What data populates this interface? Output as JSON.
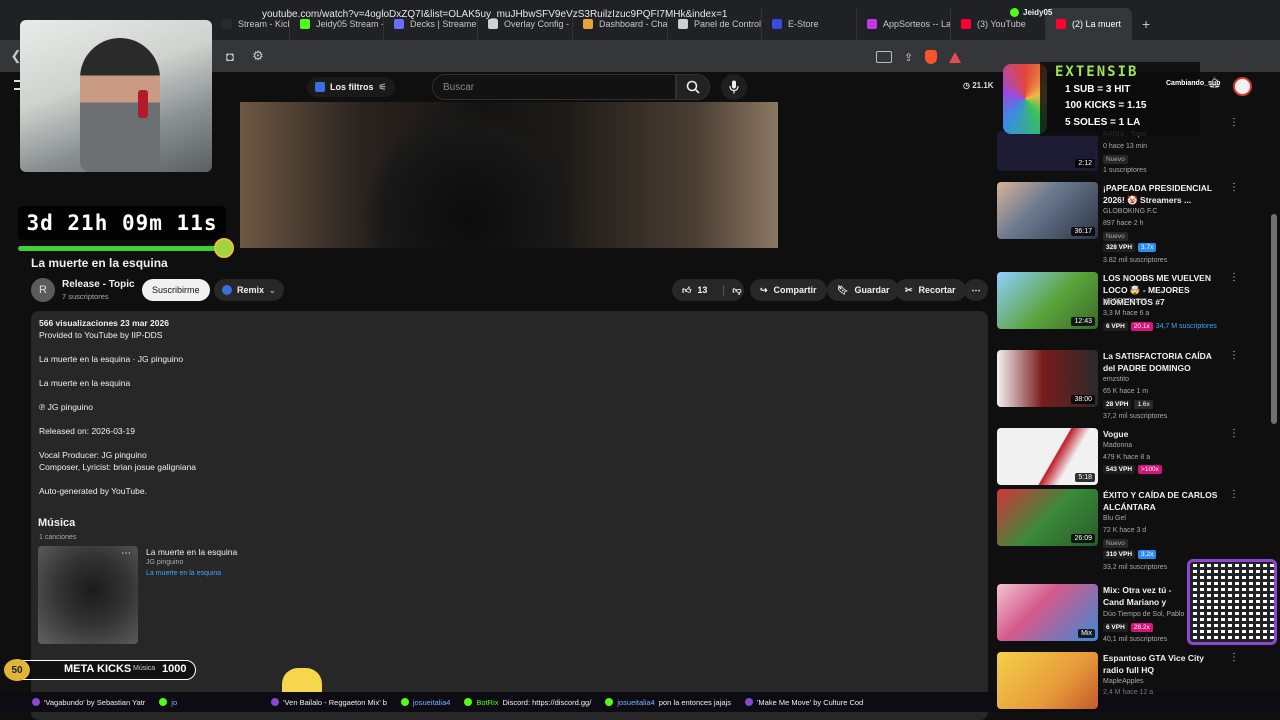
{
  "browser": {
    "tabs": [
      {
        "label": "Stream - Kick Da",
        "color": "#2a2a2a"
      },
      {
        "label": "Jeidy05 Stream -",
        "color": "#53fc18"
      },
      {
        "label": "Decks | Streamer",
        "color": "#6b6bff"
      },
      {
        "label": "Overlay Config -",
        "color": "#d0d0d0"
      },
      {
        "label": "Dashboard - Cha",
        "color": "#e8a33a"
      },
      {
        "label": "Panel de Control",
        "color": "#cfcfcf"
      },
      {
        "label": "E-Store",
        "color": "#3a4ae2"
      },
      {
        "label": "AppSorteos -- La",
        "color": "#c23ae2"
      },
      {
        "label": "(3) YouTube",
        "color": "#ff0033"
      },
      {
        "label": "(2) La muert",
        "color": "#ff0033",
        "active": true
      }
    ],
    "new_tab": "+",
    "profile_name": "Jeidy05",
    "url": "youtube.com/watch?v=4ogloDxZQ7I&list=OLAK5uy_muJHbwSFV9eVzS3RuilzIzuc9PQFI7MHk&index=1"
  },
  "youtube": {
    "filters_label": "Los filtros",
    "search_placeholder": "Buscar",
    "header_count": "21.1K"
  },
  "overlay": {
    "timer": "3d 21h 09m 11s",
    "meta_num": "50",
    "meta_label": "META KICKS",
    "meta_goal": "1000",
    "meta_under": "Música",
    "ext_title": "EXTENSIB",
    "ext_rows": [
      "1 SUB = 3 HIT",
      "100 KICKS = 1.15",
      "5 SOLES = 1 LA"
    ],
    "stream_label": "Cambiando_sub"
  },
  "video": {
    "title": "La muerte en la esquina",
    "channel": "Release - Topic",
    "channel_initial": "R",
    "subscribers": "7 suscriptores",
    "subscribe": "Suscribirme",
    "remix": "Remix",
    "likes": "13",
    "share": "Compartir",
    "save": "Guardar",
    "clip": "Recortar"
  },
  "description": {
    "stats": "566 visualizaciones  23 mar 2026",
    "provided": "Provided to YouTube by IIP-DDS",
    "line1": "La muerte en la esquina · JG pinguino",
    "line2": "La muerte en la esquina",
    "line3": "℗ JG pinguino",
    "line4": "Released on: 2026-03-19",
    "line5": "Vocal Producer: JG pinguino",
    "line6": "Composer, Lyricist: brian josue galigniana",
    "line7": "Auto-generated by YouTube.",
    "music_heading": "Música",
    "music_count": "1 canciones",
    "song_title": "La muerte en la esquina",
    "song_artist": "JG pinguino",
    "song_album": "La muerte en la esquina"
  },
  "sidebar": [
    {
      "title": "",
      "channel": "RANIX - Topic",
      "meta": "0  hace 13 min",
      "duration": "2:12",
      "badges": [
        "Nuevo"
      ],
      "subs": "1 suscriptores",
      "thumb": "#1c1b33"
    },
    {
      "title": "¡PAPEADA PRESIDENCIAL 2026! 🤡 Streamers ...",
      "channel": "GLOBOKING F.C",
      "meta": "897  hace 2 h",
      "duration": "36:17",
      "badges": [
        "Nuevo"
      ],
      "vph": "328 VPH",
      "mult": "3.7x",
      "subs": "3.82 mil suscriptores",
      "thumb": "#6c7a90"
    },
    {
      "title": "LOS NOOBS ME VUELVEN LOCO 🤯 - MEJORES MOMENTOS #7",
      "channel": "VEGETTA777",
      "meta": "3,3 M  hace 6 a",
      "duration": "12:43",
      "vph": "6 VPH",
      "mult": "20.1x",
      "subs": "34,7 M suscriptores",
      "thumb": "#5aa33a"
    },
    {
      "title": "La SATISFACTORIA CAÍDA del PADRE DOMINGO",
      "channel": "emzstito",
      "meta": "65 K  hace 1 m",
      "duration": "38:00",
      "vph": "28 VPH",
      "mult": "1.6x",
      "subs": "37,2 mil suscriptores",
      "thumb": "#7a1c1c"
    },
    {
      "title": "Vogue",
      "channel": "Madonna",
      "meta": "479 K  hace 8 a",
      "duration": "5:18",
      "vph": "543 VPH",
      "mult": ">100x",
      "subs": "",
      "thumb": "#d9d9d9"
    },
    {
      "title": "ÉXITO Y CAÍDA DE CARLOS ALCÁNTARA",
      "channel": "Blu Gel",
      "meta": "72 K  hace 3 d",
      "duration": "26:09",
      "badges": [
        "Nuevo"
      ],
      "vph": "310 VPH",
      "mult": "3.2x",
      "subs": "33,2 mil suscriptores",
      "thumb": "#3a8a3a"
    },
    {
      "title": "Mix: Otra vez tú - Cand Mariano y Teresa (letr",
      "channel": "Dúo Tiempo de Sol, Pablo",
      "meta": "",
      "duration": "Mix",
      "vph": "6 VPH",
      "mult": "28.2x",
      "subs": "40,1 mil suscriptores",
      "thumb": "#d45a8a"
    },
    {
      "title": "Espantoso GTA Vice City radio full HQ",
      "channel": "MapleApples",
      "meta": "2,4 M  hace 12 a",
      "duration": "",
      "thumb": "#e89a3a"
    }
  ],
  "ticker": [
    {
      "user": "",
      "text": "'Vagabundo' by Sebastian Yatr",
      "color": "#8a47d1"
    },
    {
      "user": "jo",
      "text": "",
      "color": "#53fc18"
    },
    {
      "user": "",
      "text": "'Ven Bailalo - Reggaeton Mix' b",
      "color": "#8a47d1"
    },
    {
      "user": "josueitalia4",
      "text": "",
      "color": "#53fc18"
    },
    {
      "user": "BotRix",
      "text": "Discord: https://discord.gg/",
      "color": "#53fc18"
    },
    {
      "user": "josueitalia4",
      "text": "pon la entonces jajajs",
      "color": "#53fc18"
    },
    {
      "user": "",
      "text": "'Make Me Move' by Culture Cod",
      "color": "#8a47d1"
    }
  ]
}
